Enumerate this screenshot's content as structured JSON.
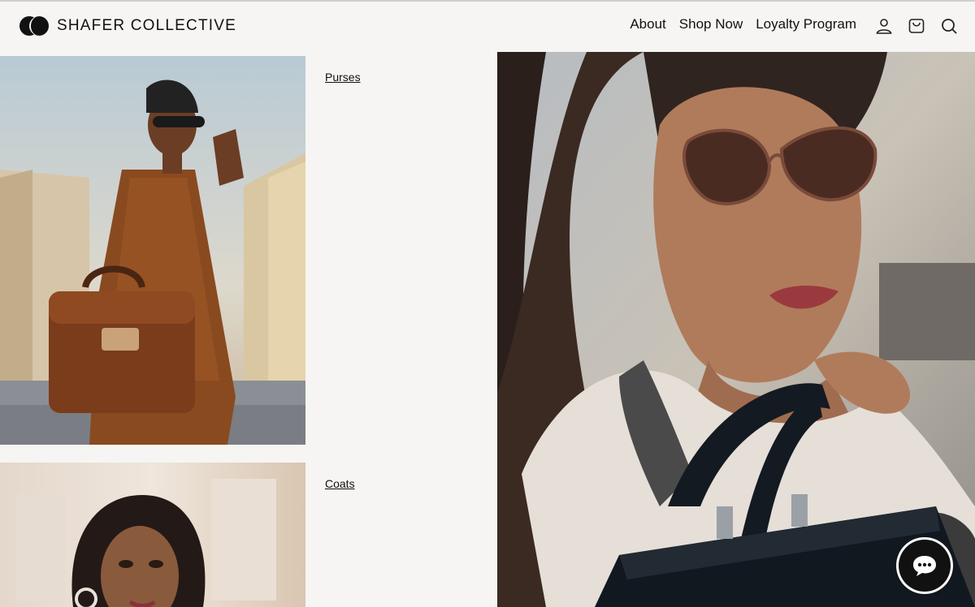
{
  "brand": {
    "name": "SHAFER COLLECTIVE",
    "logo_icon": "double-circle-logo"
  },
  "nav": {
    "items": [
      {
        "label": "About"
      },
      {
        "label": "Shop Now"
      },
      {
        "label": "Loyalty Program"
      }
    ]
  },
  "header_icons": [
    "account-icon",
    "cart-icon",
    "search-icon"
  ],
  "products": [
    {
      "label": "Purses",
      "image": "woman in striped brown outfit with leather handbag"
    },
    {
      "label": "Coats",
      "image": "woman portrait with hoop earrings"
    }
  ],
  "hero": {
    "image": "woman in sunglasses and light coat holding black handbag"
  },
  "chat": {
    "icon": "chat-bubble-icon"
  },
  "colors": {
    "background": "#f6f5f3",
    "text": "#111111",
    "chat_button": "#111111"
  }
}
